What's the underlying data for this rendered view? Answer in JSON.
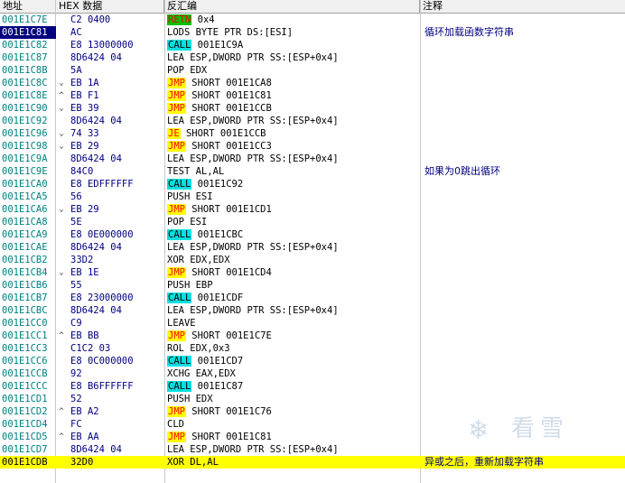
{
  "columns": {
    "address": "地址",
    "hex": "HEX 数据",
    "disasm": "反汇编",
    "comment": "注释"
  },
  "colors": {
    "address": "#008080",
    "selected_bg": "#000080",
    "highlight_bg": "#ffff00",
    "call_bg": "#00e0e0",
    "jmp_bg": "#ffff00",
    "ret_bg": "#00c000"
  },
  "rows": [
    {
      "addr": "001E1C7E",
      "mark": "",
      "hex": "C2 0400",
      "mn": "RETN",
      "ops": " 0x4",
      "kind": "ret",
      "comment": ""
    },
    {
      "addr": "001E1C81",
      "mark": "",
      "hex": "AC",
      "mn": "",
      "ops": "LODS BYTE PTR DS:[ESI]",
      "kind": "",
      "comment": "循环加载函数字符串",
      "selected": true
    },
    {
      "addr": "001E1C82",
      "mark": "",
      "hex": "E8 13000000",
      "mn": "CALL",
      "ops": " 001E1C9A",
      "kind": "call",
      "comment": ""
    },
    {
      "addr": "001E1C87",
      "mark": "",
      "hex": "8D6424 04",
      "mn": "",
      "ops": "LEA ESP,DWORD PTR SS:[ESP+0x4]",
      "kind": "",
      "comment": ""
    },
    {
      "addr": "001E1C8B",
      "mark": "",
      "hex": "5A",
      "mn": "",
      "ops": "POP EDX",
      "kind": "",
      "comment": ""
    },
    {
      "addr": "001E1C8C",
      "mark": "⌄",
      "hex": "EB 1A",
      "mn": "JMP",
      "ops": " SHORT 001E1CA8",
      "kind": "jmp",
      "comment": ""
    },
    {
      "addr": "001E1C8E",
      "mark": "^",
      "hex": "EB F1",
      "mn": "JMP",
      "ops": " SHORT 001E1C81",
      "kind": "jmp",
      "comment": ""
    },
    {
      "addr": "001E1C90",
      "mark": "⌄",
      "hex": "EB 39",
      "mn": "JMP",
      "ops": " SHORT 001E1CCB",
      "kind": "jmp",
      "comment": ""
    },
    {
      "addr": "001E1C92",
      "mark": "",
      "hex": "8D6424 04",
      "mn": "",
      "ops": "LEA ESP,DWORD PTR SS:[ESP+0x4]",
      "kind": "",
      "comment": ""
    },
    {
      "addr": "001E1C96",
      "mark": "⌄",
      "hex": "74 33",
      "mn": "JE",
      "ops": " SHORT 001E1CCB",
      "kind": "jmp",
      "comment": ""
    },
    {
      "addr": "001E1C98",
      "mark": "⌄",
      "hex": "EB 29",
      "mn": "JMP",
      "ops": " SHORT 001E1CC3",
      "kind": "jmp",
      "comment": ""
    },
    {
      "addr": "001E1C9A",
      "mark": "",
      "hex": "8D6424 04",
      "mn": "",
      "ops": "LEA ESP,DWORD PTR SS:[ESP+0x4]",
      "kind": "",
      "comment": ""
    },
    {
      "addr": "001E1C9E",
      "mark": "",
      "hex": "84C0",
      "mn": "",
      "ops": "TEST AL,AL",
      "kind": "",
      "comment": "如果为0跳出循环"
    },
    {
      "addr": "001E1CA0",
      "mark": "",
      "hex": "E8 EDFFFFFF",
      "mn": "CALL",
      "ops": " 001E1C92",
      "kind": "call",
      "comment": ""
    },
    {
      "addr": "001E1CA5",
      "mark": "",
      "hex": "56",
      "mn": "",
      "ops": "PUSH ESI",
      "kind": "",
      "comment": ""
    },
    {
      "addr": "001E1CA6",
      "mark": "⌄",
      "hex": "EB 29",
      "mn": "JMP",
      "ops": " SHORT 001E1CD1",
      "kind": "jmp",
      "comment": ""
    },
    {
      "addr": "001E1CA8",
      "mark": "",
      "hex": "5E",
      "mn": "",
      "ops": "POP ESI",
      "kind": "",
      "comment": ""
    },
    {
      "addr": "001E1CA9",
      "mark": "",
      "hex": "E8 0E000000",
      "mn": "CALL",
      "ops": " 001E1CBC",
      "kind": "call",
      "comment": ""
    },
    {
      "addr": "001E1CAE",
      "mark": "",
      "hex": "8D6424 04",
      "mn": "",
      "ops": "LEA ESP,DWORD PTR SS:[ESP+0x4]",
      "kind": "",
      "comment": ""
    },
    {
      "addr": "001E1CB2",
      "mark": "",
      "hex": "33D2",
      "mn": "",
      "ops": "XOR EDX,EDX",
      "kind": "",
      "comment": ""
    },
    {
      "addr": "001E1CB4",
      "mark": "⌄",
      "hex": "EB 1E",
      "mn": "JMP",
      "ops": " SHORT 001E1CD4",
      "kind": "jmp",
      "comment": ""
    },
    {
      "addr": "001E1CB6",
      "mark": "",
      "hex": "55",
      "mn": "",
      "ops": "PUSH EBP",
      "kind": "",
      "comment": ""
    },
    {
      "addr": "001E1CB7",
      "mark": "",
      "hex": "E8 23000000",
      "mn": "CALL",
      "ops": " 001E1CDF",
      "kind": "call",
      "comment": ""
    },
    {
      "addr": "001E1CBC",
      "mark": "",
      "hex": "8D6424 04",
      "mn": "",
      "ops": "LEA ESP,DWORD PTR SS:[ESP+0x4]",
      "kind": "",
      "comment": ""
    },
    {
      "addr": "001E1CC0",
      "mark": "",
      "hex": "C9",
      "mn": "",
      "ops": "LEAVE",
      "kind": "",
      "comment": ""
    },
    {
      "addr": "001E1CC1",
      "mark": "^",
      "hex": "EB BB",
      "mn": "JMP",
      "ops": " SHORT 001E1C7E",
      "kind": "jmp",
      "comment": ""
    },
    {
      "addr": "001E1CC3",
      "mark": "",
      "hex": "C1C2 03",
      "mn": "",
      "ops": "ROL EDX,0x3",
      "kind": "",
      "comment": ""
    },
    {
      "addr": "001E1CC6",
      "mark": "",
      "hex": "E8 0C000000",
      "mn": "CALL",
      "ops": " 001E1CD7",
      "kind": "call",
      "comment": ""
    },
    {
      "addr": "001E1CCB",
      "mark": "",
      "hex": "92",
      "mn": "",
      "ops": "XCHG EAX,EDX",
      "kind": "",
      "comment": ""
    },
    {
      "addr": "001E1CCC",
      "mark": "",
      "hex": "E8 B6FFFFFF",
      "mn": "CALL",
      "ops": " 001E1C87",
      "kind": "call",
      "comment": ""
    },
    {
      "addr": "001E1CD1",
      "mark": "",
      "hex": "52",
      "mn": "",
      "ops": "PUSH EDX",
      "kind": "",
      "comment": ""
    },
    {
      "addr": "001E1CD2",
      "mark": "^",
      "hex": "EB A2",
      "mn": "JMP",
      "ops": " SHORT 001E1C76",
      "kind": "jmp",
      "comment": ""
    },
    {
      "addr": "001E1CD4",
      "mark": "",
      "hex": "FC",
      "mn": "",
      "ops": "CLD",
      "kind": "",
      "comment": ""
    },
    {
      "addr": "001E1CD5",
      "mark": "^",
      "hex": "EB AA",
      "mn": "JMP",
      "ops": " SHORT 001E1C81",
      "kind": "jmp",
      "comment": ""
    },
    {
      "addr": "001E1CD7",
      "mark": "",
      "hex": "8D6424 04",
      "mn": "",
      "ops": "LEA ESP,DWORD PTR SS:[ESP+0x4]",
      "kind": "",
      "comment": ""
    },
    {
      "addr": "001E1CDB",
      "mark": "",
      "hex": "32D0",
      "mn": "",
      "ops": "XOR DL,AL",
      "kind": "",
      "comment": "异或之后，重新加载字符串",
      "highlight": true
    }
  ],
  "watermark": {
    "icon": "snowflake-icon",
    "text": "看雪"
  }
}
